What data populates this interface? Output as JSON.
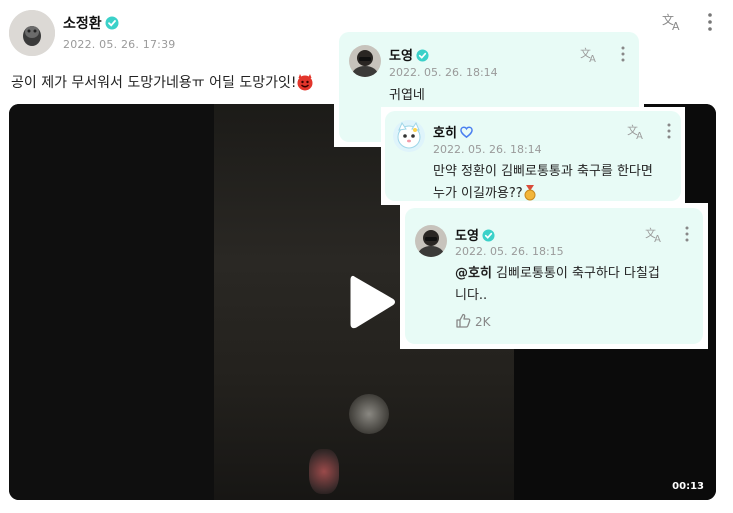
{
  "post": {
    "author": "소정환",
    "timestamp": "2022. 05. 26. 17:39",
    "text": "공이 제가 무서워서 도망가네용ㅠ 어딜 도망가잇!",
    "text_emoji": "devil-emoji",
    "video": {
      "duration": "00:13"
    },
    "colors": {
      "verified": "#3bd1c9",
      "accent_bg": "#e8fbf6"
    }
  },
  "comments": [
    {
      "author": "도영",
      "timestamp": "2022. 05. 26. 18:14",
      "text": "귀엽네",
      "verified": "teal"
    },
    {
      "author": "호히",
      "timestamp": "2022. 05. 26. 18:14",
      "text_line1": "만약 정환이 김삐로통통과 축구를 한다면",
      "text_line2": "누가 이길까용??",
      "verified": "blue-outline",
      "text_emoji": "medal-emoji"
    },
    {
      "author": "도영",
      "timestamp": "2022. 05. 26. 18:15",
      "mention": "@호히",
      "text_line1": " 김삐로통통이 축구하다 다칠겁",
      "text_line2": "니다..",
      "likes": "2K",
      "verified": "teal"
    }
  ]
}
